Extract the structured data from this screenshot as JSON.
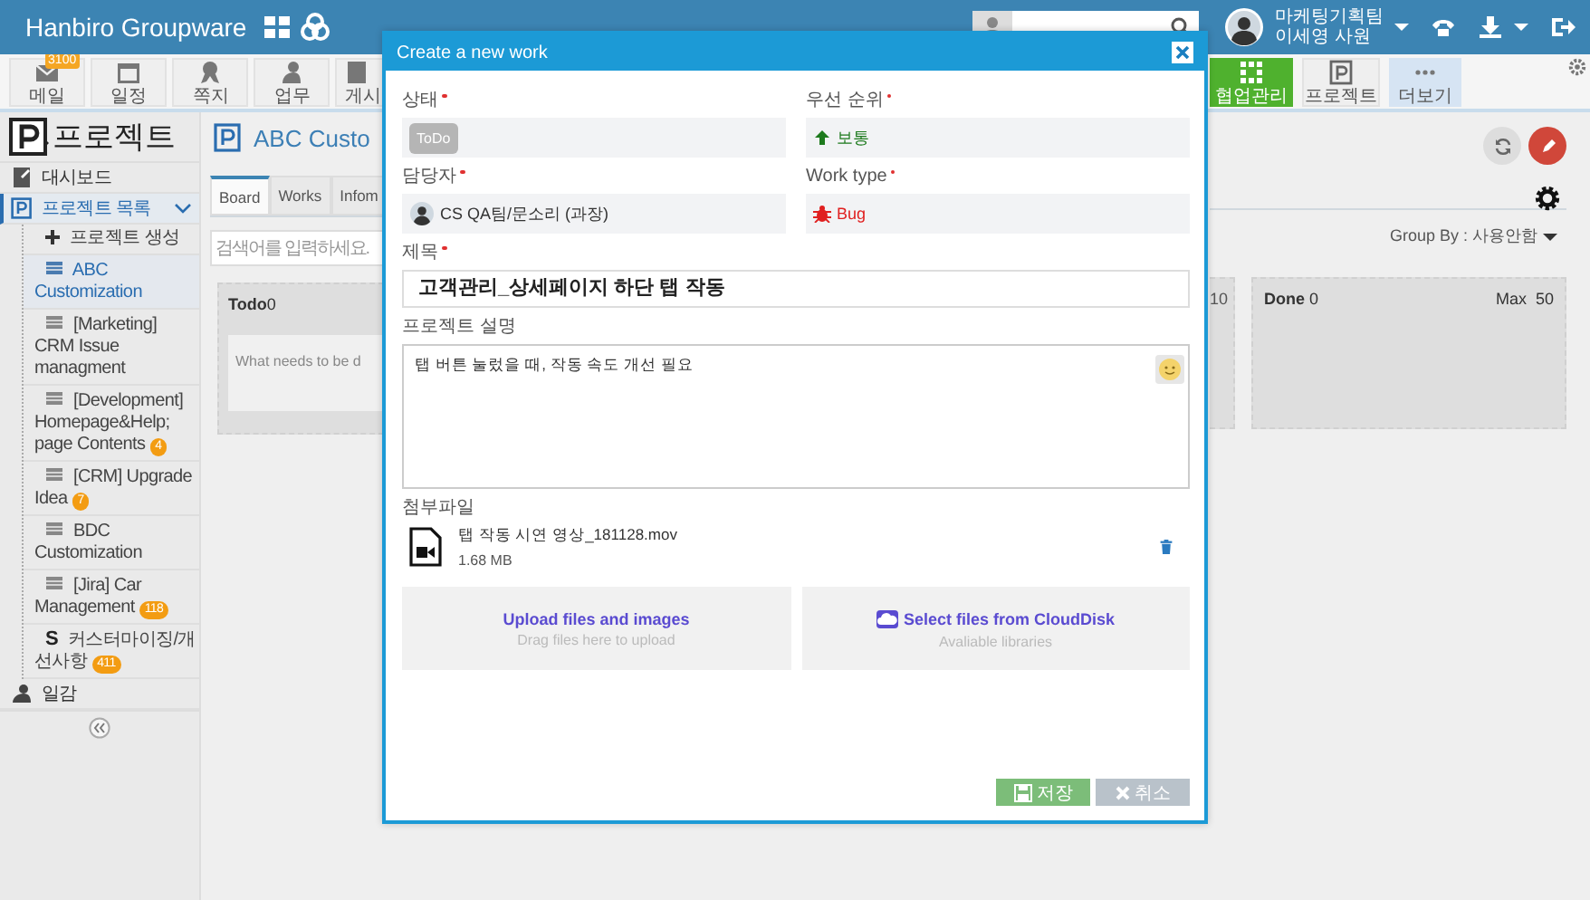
{
  "app": {
    "title": "Hanbiro Groupware"
  },
  "user": {
    "team": "마케팅기획팀",
    "name": "이세영 사원"
  },
  "toolbar": {
    "left": [
      {
        "label": "메일",
        "badge": "3100",
        "kind": "app"
      },
      {
        "label": "일정",
        "kind": "app"
      },
      {
        "label": "쪽지",
        "kind": "app"
      },
      {
        "label": "업무",
        "kind": "app"
      },
      {
        "label": "게시",
        "kind": "app"
      }
    ],
    "right": [
      {
        "label": "협업관리",
        "kind": "active"
      },
      {
        "label": "프로젝트",
        "kind": "app"
      },
      {
        "label": "더보기",
        "kind": "more"
      }
    ]
  },
  "sidebar": {
    "title": "프로젝트",
    "items": [
      {
        "label": "대시보드",
        "selected": false
      },
      {
        "label": "프로젝트 목록",
        "selected": true,
        "expanded": true,
        "children": [
          {
            "label": "프로젝트 생성",
            "kind": "create",
            "selected": false
          },
          {
            "label": "ABC Customization",
            "kind": "project",
            "selected": true
          },
          {
            "label": "[Marketing] CRM Issue managment",
            "kind": "project",
            "selected": false
          },
          {
            "label": "[Development] Homepage&Help; page Contents",
            "kind": "project",
            "selected": false,
            "badge": "4"
          },
          {
            "label": "[CRM] Upgrade Idea",
            "kind": "project",
            "selected": false,
            "badge": "7"
          },
          {
            "label": "BDC Customization",
            "kind": "project",
            "selected": false
          },
          {
            "label": "[Jira] Car Management",
            "kind": "project",
            "selected": false,
            "badge": "118"
          },
          {
            "label": "커스터마이징/개선사항",
            "kind": "service",
            "icon_text": "S",
            "selected": false,
            "badge": "411"
          }
        ]
      },
      {
        "label": "일감",
        "selected": false
      }
    ]
  },
  "project": {
    "title": "ABC Custo",
    "tabs": [
      {
        "label": "Board",
        "selected": true
      },
      {
        "label": "Works",
        "selected": false
      },
      {
        "label": "Infom",
        "selected": false
      }
    ],
    "search": {
      "placeholder": "검색어를 입력하세요."
    },
    "group_by": "Group By : 사용안함",
    "columns": [
      {
        "title": "Todo",
        "count": "0",
        "empty_text": "What needs to be d"
      },
      {
        "max": "10"
      },
      {
        "title": "Done",
        "count": "0",
        "max_label": "Max",
        "max": "50"
      }
    ]
  },
  "dialog": {
    "title": "Create a new work",
    "fields": [
      {
        "kind": "status",
        "label": "상태",
        "required": true,
        "value": "ToDo"
      },
      {
        "kind": "priority",
        "label": "우선 순위",
        "required": true,
        "value": "보통"
      },
      {
        "kind": "assignee",
        "label": "담당자",
        "required": true,
        "value": "CS QA팀/문소리 (과장)"
      },
      {
        "kind": "work_type",
        "label": "Work type",
        "required": true,
        "value": "Bug"
      },
      {
        "kind": "title",
        "label": "제목",
        "required": true,
        "value": "고객관리_상세페이지 하단 탭 작동"
      },
      {
        "kind": "description",
        "label": "프로젝트 설명",
        "required": false,
        "value": "탭 버튼 눌렀을 때, 작동 속도 개선 필요"
      }
    ],
    "attachments": {
      "label": "첨부파일",
      "files": [
        {
          "name": "탭 작동 시연 영상_181128.mov",
          "size": "1.68 MB"
        }
      ]
    },
    "upload": [
      {
        "title": "Upload files and images",
        "hint": "Drag files here to upload"
      },
      {
        "title": "Select files from CloudDisk",
        "hint": "Avaliable libraries"
      }
    ],
    "buttons": [
      {
        "label": "저장",
        "kind": "primary"
      },
      {
        "label": "취소",
        "kind": "cancel"
      }
    ]
  }
}
